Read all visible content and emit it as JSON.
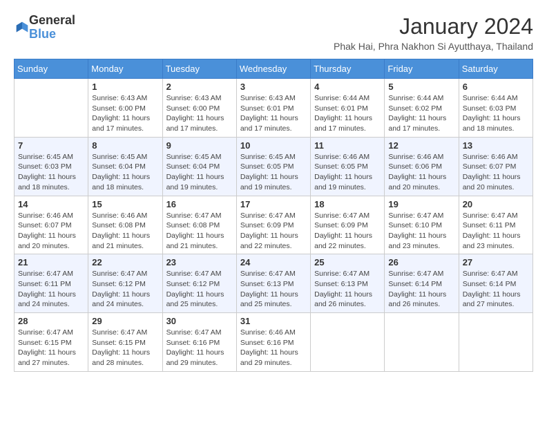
{
  "header": {
    "logo_general": "General",
    "logo_blue": "Blue",
    "month_year": "January 2024",
    "location": "Phak Hai, Phra Nakhon Si Ayutthaya, Thailand"
  },
  "calendar": {
    "days_of_week": [
      "Sunday",
      "Monday",
      "Tuesday",
      "Wednesday",
      "Thursday",
      "Friday",
      "Saturday"
    ],
    "weeks": [
      [
        {
          "day": "",
          "info": ""
        },
        {
          "day": "1",
          "info": "Sunrise: 6:43 AM\nSunset: 6:00 PM\nDaylight: 11 hours\nand 17 minutes."
        },
        {
          "day": "2",
          "info": "Sunrise: 6:43 AM\nSunset: 6:00 PM\nDaylight: 11 hours\nand 17 minutes."
        },
        {
          "day": "3",
          "info": "Sunrise: 6:43 AM\nSunset: 6:01 PM\nDaylight: 11 hours\nand 17 minutes."
        },
        {
          "day": "4",
          "info": "Sunrise: 6:44 AM\nSunset: 6:01 PM\nDaylight: 11 hours\nand 17 minutes."
        },
        {
          "day": "5",
          "info": "Sunrise: 6:44 AM\nSunset: 6:02 PM\nDaylight: 11 hours\nand 17 minutes."
        },
        {
          "day": "6",
          "info": "Sunrise: 6:44 AM\nSunset: 6:03 PM\nDaylight: 11 hours\nand 18 minutes."
        }
      ],
      [
        {
          "day": "7",
          "info": "Sunrise: 6:45 AM\nSunset: 6:03 PM\nDaylight: 11 hours\nand 18 minutes."
        },
        {
          "day": "8",
          "info": "Sunrise: 6:45 AM\nSunset: 6:04 PM\nDaylight: 11 hours\nand 18 minutes."
        },
        {
          "day": "9",
          "info": "Sunrise: 6:45 AM\nSunset: 6:04 PM\nDaylight: 11 hours\nand 19 minutes."
        },
        {
          "day": "10",
          "info": "Sunrise: 6:45 AM\nSunset: 6:05 PM\nDaylight: 11 hours\nand 19 minutes."
        },
        {
          "day": "11",
          "info": "Sunrise: 6:46 AM\nSunset: 6:05 PM\nDaylight: 11 hours\nand 19 minutes."
        },
        {
          "day": "12",
          "info": "Sunrise: 6:46 AM\nSunset: 6:06 PM\nDaylight: 11 hours\nand 20 minutes."
        },
        {
          "day": "13",
          "info": "Sunrise: 6:46 AM\nSunset: 6:07 PM\nDaylight: 11 hours\nand 20 minutes."
        }
      ],
      [
        {
          "day": "14",
          "info": "Sunrise: 6:46 AM\nSunset: 6:07 PM\nDaylight: 11 hours\nand 20 minutes."
        },
        {
          "day": "15",
          "info": "Sunrise: 6:46 AM\nSunset: 6:08 PM\nDaylight: 11 hours\nand 21 minutes."
        },
        {
          "day": "16",
          "info": "Sunrise: 6:47 AM\nSunset: 6:08 PM\nDaylight: 11 hours\nand 21 minutes."
        },
        {
          "day": "17",
          "info": "Sunrise: 6:47 AM\nSunset: 6:09 PM\nDaylight: 11 hours\nand 22 minutes."
        },
        {
          "day": "18",
          "info": "Sunrise: 6:47 AM\nSunset: 6:09 PM\nDaylight: 11 hours\nand 22 minutes."
        },
        {
          "day": "19",
          "info": "Sunrise: 6:47 AM\nSunset: 6:10 PM\nDaylight: 11 hours\nand 23 minutes."
        },
        {
          "day": "20",
          "info": "Sunrise: 6:47 AM\nSunset: 6:11 PM\nDaylight: 11 hours\nand 23 minutes."
        }
      ],
      [
        {
          "day": "21",
          "info": "Sunrise: 6:47 AM\nSunset: 6:11 PM\nDaylight: 11 hours\nand 24 minutes."
        },
        {
          "day": "22",
          "info": "Sunrise: 6:47 AM\nSunset: 6:12 PM\nDaylight: 11 hours\nand 24 minutes."
        },
        {
          "day": "23",
          "info": "Sunrise: 6:47 AM\nSunset: 6:12 PM\nDaylight: 11 hours\nand 25 minutes."
        },
        {
          "day": "24",
          "info": "Sunrise: 6:47 AM\nSunset: 6:13 PM\nDaylight: 11 hours\nand 25 minutes."
        },
        {
          "day": "25",
          "info": "Sunrise: 6:47 AM\nSunset: 6:13 PM\nDaylight: 11 hours\nand 26 minutes."
        },
        {
          "day": "26",
          "info": "Sunrise: 6:47 AM\nSunset: 6:14 PM\nDaylight: 11 hours\nand 26 minutes."
        },
        {
          "day": "27",
          "info": "Sunrise: 6:47 AM\nSunset: 6:14 PM\nDaylight: 11 hours\nand 27 minutes."
        }
      ],
      [
        {
          "day": "28",
          "info": "Sunrise: 6:47 AM\nSunset: 6:15 PM\nDaylight: 11 hours\nand 27 minutes."
        },
        {
          "day": "29",
          "info": "Sunrise: 6:47 AM\nSunset: 6:15 PM\nDaylight: 11 hours\nand 28 minutes."
        },
        {
          "day": "30",
          "info": "Sunrise: 6:47 AM\nSunset: 6:16 PM\nDaylight: 11 hours\nand 29 minutes."
        },
        {
          "day": "31",
          "info": "Sunrise: 6:46 AM\nSunset: 6:16 PM\nDaylight: 11 hours\nand 29 minutes."
        },
        {
          "day": "",
          "info": ""
        },
        {
          "day": "",
          "info": ""
        },
        {
          "day": "",
          "info": ""
        }
      ]
    ]
  }
}
